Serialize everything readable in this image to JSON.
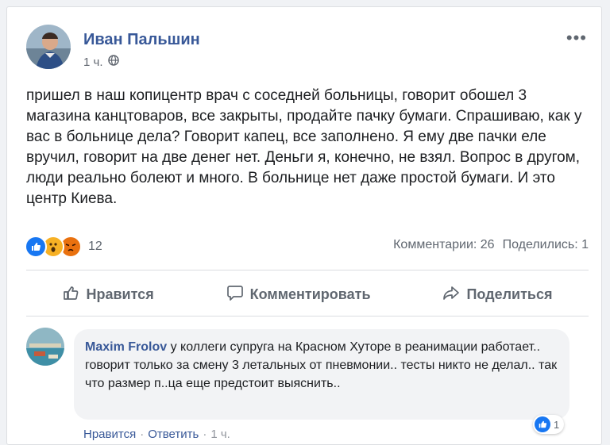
{
  "post": {
    "author": "Иван Пальшин",
    "time": "1 ч.",
    "text": "пришел в наш копицентр врач с соседней больницы, говорит обошел 3 магазина канцтоваров, все закрыты, продайте пачку бумаги. Спрашиваю, как у вас в больнице дела? Говорит капец, все заполнено. Я ему две пачки еле вручил, говорит на две денег нет. Деньги я, конечно, не взял. Вопрос в другом, люди реально болеют и много. В больнице нет даже простой бумаги. И это центр Киева.",
    "reaction_count": "12",
    "comments_count": "Комментарии: 26",
    "shares_count": "Поделились: 1",
    "more_icon": "•••"
  },
  "actions": {
    "like": "Нравится",
    "comment": "Комментировать",
    "share": "Поделиться"
  },
  "comment": {
    "author": "Maxim Frolov",
    "text": "у коллеги супруга на Красном Хуторе в реанимации работает.. говорит только за смену 3 летальных от пневмонии.. тесты никто не делал.. так что размер п..ца еще предстоит выяснить..",
    "reaction_count": "1",
    "like": "Нравится",
    "reply": "Ответить",
    "time": "1 ч.",
    "separator": "·"
  },
  "colors": {
    "like_blue": "#1877f2",
    "wow_yellow": "#f7b125",
    "angry_orange": "#e9710f",
    "link_blue": "#385898"
  }
}
